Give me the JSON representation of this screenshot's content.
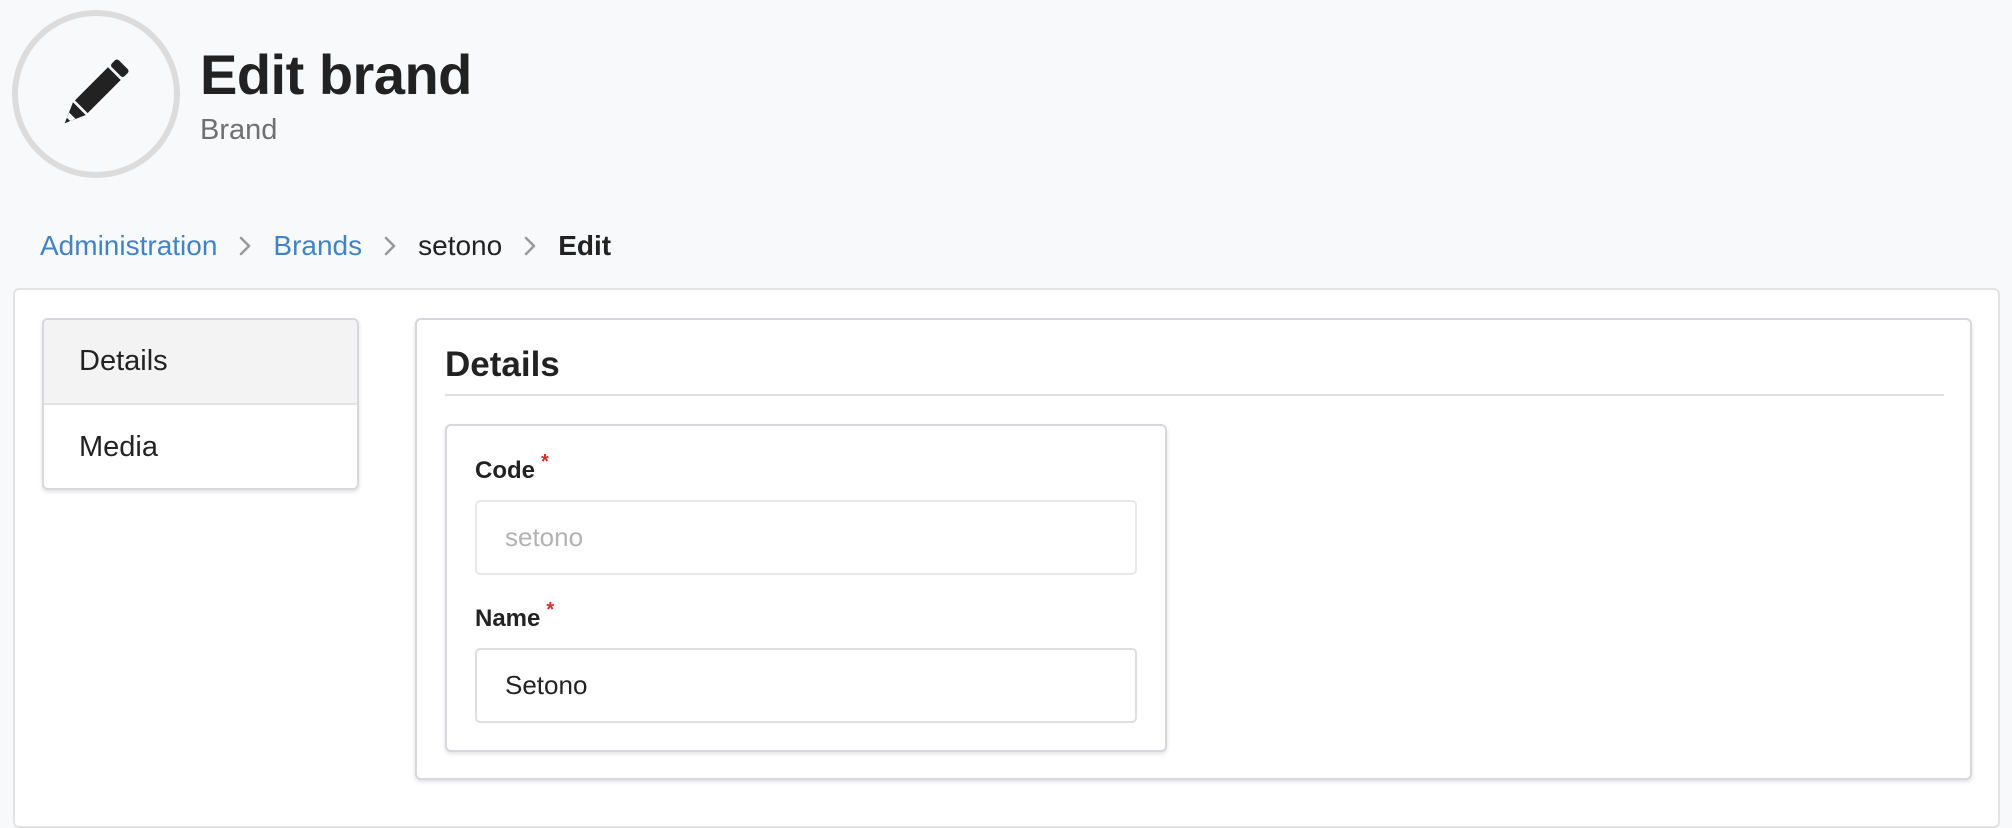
{
  "header": {
    "icon": "pencil-icon",
    "title": "Edit brand",
    "subtitle": "Brand"
  },
  "breadcrumb": {
    "items": [
      {
        "label": "Administration",
        "type": "link"
      },
      {
        "label": "Brands",
        "type": "link"
      },
      {
        "label": "setono",
        "type": "text"
      },
      {
        "label": "Edit",
        "type": "active"
      }
    ],
    "separator_icon": "chevron-right-icon"
  },
  "sidebar": {
    "items": [
      {
        "label": "Details",
        "active": true
      },
      {
        "label": "Media",
        "active": false
      }
    ]
  },
  "details": {
    "heading": "Details",
    "fields": {
      "code": {
        "label": "Code",
        "required_mark": "*",
        "value": "setono",
        "disabled": true
      },
      "name": {
        "label": "Name",
        "required_mark": "*",
        "value": "Setono",
        "disabled": false
      }
    }
  },
  "colors": {
    "link": "#4183c4",
    "required": "#db2828",
    "page_background": "#f8f9fa"
  }
}
